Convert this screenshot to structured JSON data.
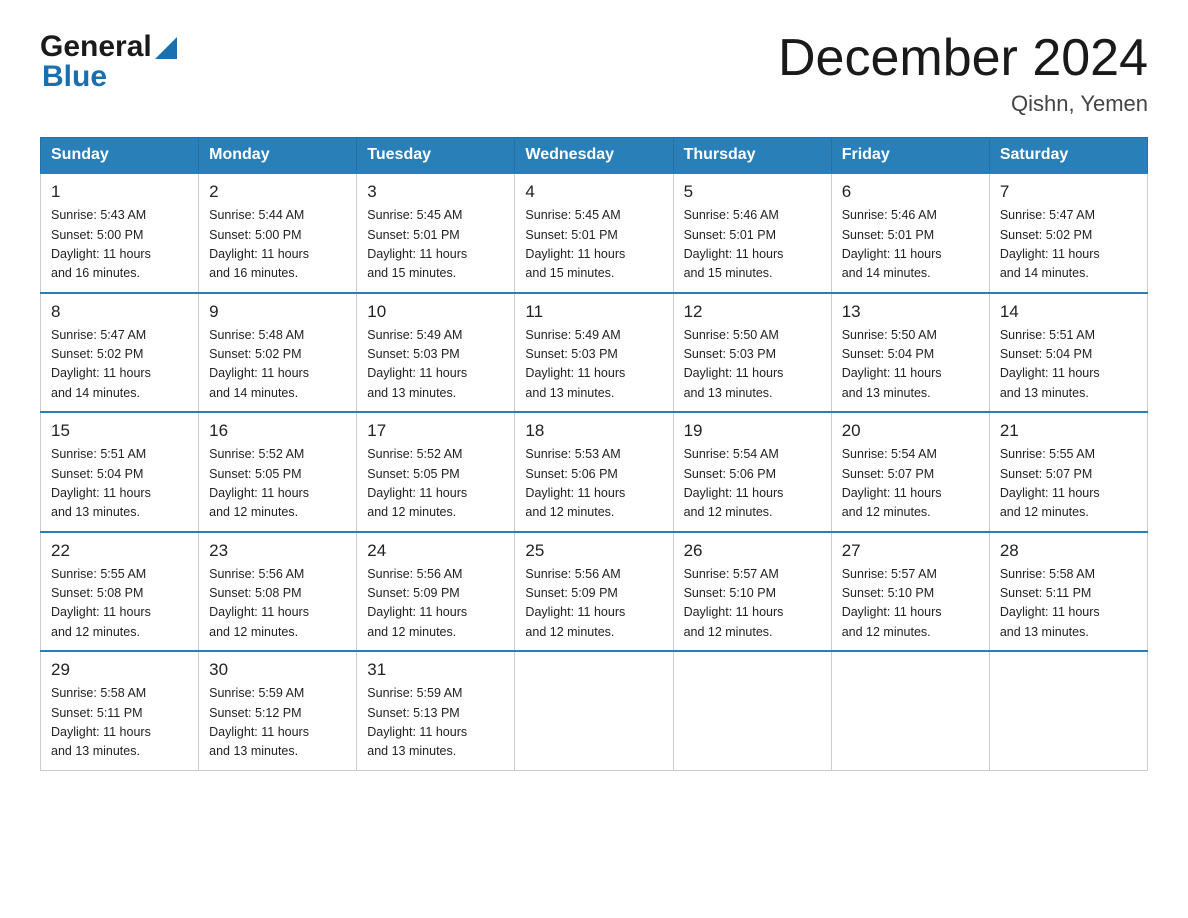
{
  "header": {
    "logo_general": "General",
    "logo_blue": "Blue",
    "title": "December 2024",
    "subtitle": "Qishn, Yemen"
  },
  "weekdays": [
    "Sunday",
    "Monday",
    "Tuesday",
    "Wednesday",
    "Thursday",
    "Friday",
    "Saturday"
  ],
  "weeks": [
    [
      {
        "day": "1",
        "sunrise": "5:43 AM",
        "sunset": "5:00 PM",
        "daylight": "11 hours and 16 minutes."
      },
      {
        "day": "2",
        "sunrise": "5:44 AM",
        "sunset": "5:00 PM",
        "daylight": "11 hours and 16 minutes."
      },
      {
        "day": "3",
        "sunrise": "5:45 AM",
        "sunset": "5:01 PM",
        "daylight": "11 hours and 15 minutes."
      },
      {
        "day": "4",
        "sunrise": "5:45 AM",
        "sunset": "5:01 PM",
        "daylight": "11 hours and 15 minutes."
      },
      {
        "day": "5",
        "sunrise": "5:46 AM",
        "sunset": "5:01 PM",
        "daylight": "11 hours and 15 minutes."
      },
      {
        "day": "6",
        "sunrise": "5:46 AM",
        "sunset": "5:01 PM",
        "daylight": "11 hours and 14 minutes."
      },
      {
        "day": "7",
        "sunrise": "5:47 AM",
        "sunset": "5:02 PM",
        "daylight": "11 hours and 14 minutes."
      }
    ],
    [
      {
        "day": "8",
        "sunrise": "5:47 AM",
        "sunset": "5:02 PM",
        "daylight": "11 hours and 14 minutes."
      },
      {
        "day": "9",
        "sunrise": "5:48 AM",
        "sunset": "5:02 PM",
        "daylight": "11 hours and 14 minutes."
      },
      {
        "day": "10",
        "sunrise": "5:49 AM",
        "sunset": "5:03 PM",
        "daylight": "11 hours and 13 minutes."
      },
      {
        "day": "11",
        "sunrise": "5:49 AM",
        "sunset": "5:03 PM",
        "daylight": "11 hours and 13 minutes."
      },
      {
        "day": "12",
        "sunrise": "5:50 AM",
        "sunset": "5:03 PM",
        "daylight": "11 hours and 13 minutes."
      },
      {
        "day": "13",
        "sunrise": "5:50 AM",
        "sunset": "5:04 PM",
        "daylight": "11 hours and 13 minutes."
      },
      {
        "day": "14",
        "sunrise": "5:51 AM",
        "sunset": "5:04 PM",
        "daylight": "11 hours and 13 minutes."
      }
    ],
    [
      {
        "day": "15",
        "sunrise": "5:51 AM",
        "sunset": "5:04 PM",
        "daylight": "11 hours and 13 minutes."
      },
      {
        "day": "16",
        "sunrise": "5:52 AM",
        "sunset": "5:05 PM",
        "daylight": "11 hours and 12 minutes."
      },
      {
        "day": "17",
        "sunrise": "5:52 AM",
        "sunset": "5:05 PM",
        "daylight": "11 hours and 12 minutes."
      },
      {
        "day": "18",
        "sunrise": "5:53 AM",
        "sunset": "5:06 PM",
        "daylight": "11 hours and 12 minutes."
      },
      {
        "day": "19",
        "sunrise": "5:54 AM",
        "sunset": "5:06 PM",
        "daylight": "11 hours and 12 minutes."
      },
      {
        "day": "20",
        "sunrise": "5:54 AM",
        "sunset": "5:07 PM",
        "daylight": "11 hours and 12 minutes."
      },
      {
        "day": "21",
        "sunrise": "5:55 AM",
        "sunset": "5:07 PM",
        "daylight": "11 hours and 12 minutes."
      }
    ],
    [
      {
        "day": "22",
        "sunrise": "5:55 AM",
        "sunset": "5:08 PM",
        "daylight": "11 hours and 12 minutes."
      },
      {
        "day": "23",
        "sunrise": "5:56 AM",
        "sunset": "5:08 PM",
        "daylight": "11 hours and 12 minutes."
      },
      {
        "day": "24",
        "sunrise": "5:56 AM",
        "sunset": "5:09 PM",
        "daylight": "11 hours and 12 minutes."
      },
      {
        "day": "25",
        "sunrise": "5:56 AM",
        "sunset": "5:09 PM",
        "daylight": "11 hours and 12 minutes."
      },
      {
        "day": "26",
        "sunrise": "5:57 AM",
        "sunset": "5:10 PM",
        "daylight": "11 hours and 12 minutes."
      },
      {
        "day": "27",
        "sunrise": "5:57 AM",
        "sunset": "5:10 PM",
        "daylight": "11 hours and 12 minutes."
      },
      {
        "day": "28",
        "sunrise": "5:58 AM",
        "sunset": "5:11 PM",
        "daylight": "11 hours and 13 minutes."
      }
    ],
    [
      {
        "day": "29",
        "sunrise": "5:58 AM",
        "sunset": "5:11 PM",
        "daylight": "11 hours and 13 minutes."
      },
      {
        "day": "30",
        "sunrise": "5:59 AM",
        "sunset": "5:12 PM",
        "daylight": "11 hours and 13 minutes."
      },
      {
        "day": "31",
        "sunrise": "5:59 AM",
        "sunset": "5:13 PM",
        "daylight": "11 hours and 13 minutes."
      },
      null,
      null,
      null,
      null
    ]
  ],
  "labels": {
    "sunrise": "Sunrise:",
    "sunset": "Sunset:",
    "daylight": "Daylight:"
  }
}
